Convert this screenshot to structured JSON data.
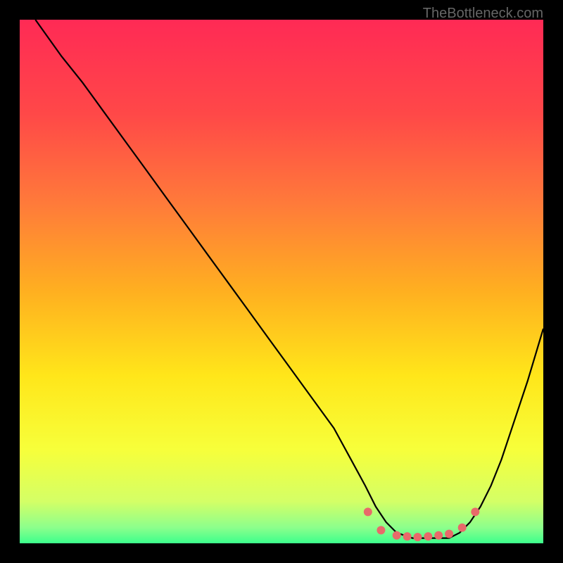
{
  "watermark": "TheBottleneck.com",
  "chart_data": {
    "type": "line",
    "title": "",
    "xlabel": "",
    "ylabel": "",
    "xlim": [
      0,
      100
    ],
    "ylim": [
      0,
      100
    ],
    "grid": false,
    "series": [
      {
        "name": "bottleneck-curve",
        "x": [
          3,
          8,
          12,
          16,
          20,
          24,
          28,
          32,
          36,
          40,
          44,
          48,
          52,
          56,
          60,
          63,
          66,
          68,
          70,
          72,
          75,
          78,
          80,
          82,
          84,
          86,
          88,
          90,
          92,
          94,
          97,
          100
        ],
        "y": [
          100,
          93,
          88,
          82.5,
          77,
          71.5,
          66,
          60.5,
          55,
          49.5,
          44,
          38.5,
          33,
          27.5,
          22,
          16.5,
          11,
          7,
          4,
          2,
          1,
          1,
          1,
          1,
          2,
          4,
          7,
          11,
          16,
          22,
          31,
          41
        ],
        "color": "#000000"
      }
    ],
    "markers": {
      "name": "valley-dots",
      "points": [
        {
          "x": 66.5,
          "y": 6
        },
        {
          "x": 69,
          "y": 2.5
        },
        {
          "x": 72,
          "y": 1.5
        },
        {
          "x": 74,
          "y": 1.3
        },
        {
          "x": 76,
          "y": 1.2
        },
        {
          "x": 78,
          "y": 1.3
        },
        {
          "x": 80,
          "y": 1.5
        },
        {
          "x": 82,
          "y": 1.8
        },
        {
          "x": 84.5,
          "y": 3
        },
        {
          "x": 87,
          "y": 6
        }
      ],
      "color": "#e86a6a"
    },
    "gradient_stops": [
      {
        "offset": 0,
        "color": "#ff2a55"
      },
      {
        "offset": 0.18,
        "color": "#ff4848"
      },
      {
        "offset": 0.35,
        "color": "#ff7a3a"
      },
      {
        "offset": 0.52,
        "color": "#ffb020"
      },
      {
        "offset": 0.68,
        "color": "#ffe61a"
      },
      {
        "offset": 0.82,
        "color": "#f7ff3a"
      },
      {
        "offset": 0.92,
        "color": "#d4ff66"
      },
      {
        "offset": 0.97,
        "color": "#8cff8c"
      },
      {
        "offset": 1.0,
        "color": "#3cff8c"
      }
    ]
  }
}
